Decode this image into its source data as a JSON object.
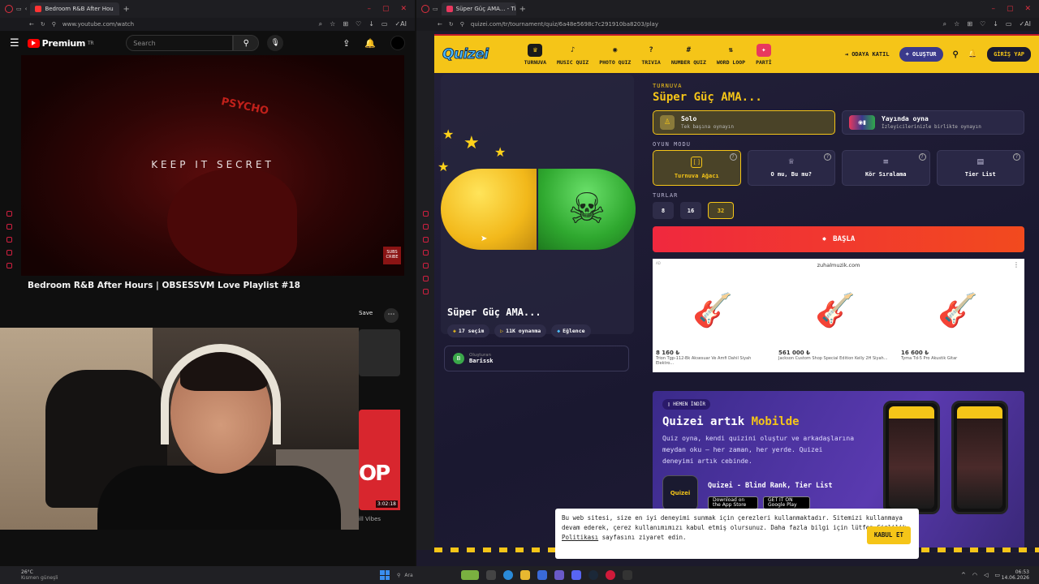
{
  "left_window": {
    "tab_title": "Bedroom R&B After Hou",
    "url": "www.youtube.com/watch",
    "youtube": {
      "brand": "Premium",
      "brand_sup": "TR",
      "search_placeholder": "Search",
      "video_text_top": "PSYCHO",
      "video_text_main": "KEEP IT SECRET",
      "subscribe_badge": "SUBS CRIBE",
      "video_title": "Bedroom R&B After Hours | OBSESSVM Love Playlist #18",
      "save_label": "Save",
      "thumb_text": "OP",
      "thumb_duration": "3:02:18",
      "thumb_channel": "ill Vibes"
    }
  },
  "right_window": {
    "tab_title": "Süper Güç AMA... - Tier Lis",
    "url": "quizei.com/tr/tournament/quiz/6a48e5698c7c291910ba8203/play",
    "site": {
      "logo": "Quizei",
      "menu": [
        {
          "label": "TURNUVA",
          "icon": "trophy-icon",
          "glyph": "♛"
        },
        {
          "label": "MUSIC QUIZ",
          "icon": "music-note-icon",
          "glyph": "♪"
        },
        {
          "label": "PHOTO QUIZ",
          "icon": "camera-icon",
          "glyph": "◉"
        },
        {
          "label": "TRIVIA",
          "icon": "help-circle-icon",
          "glyph": "?"
        },
        {
          "label": "NUMBER QUIZ",
          "icon": "hash-icon",
          "glyph": "#"
        },
        {
          "label": "WORD LOOP",
          "icon": "sort-icon",
          "glyph": "⇅"
        },
        {
          "label": "PARTİ",
          "icon": "party-icon",
          "glyph": "✦"
        }
      ],
      "join_room": "ODAYA KATIL",
      "create": "+ OLUŞTUR",
      "login": "GİRİŞ YAP",
      "quiz": {
        "title": "Süper Güç AMA...",
        "picks": "17 seçim",
        "plays": "11K oynanma",
        "category": "Eğlence",
        "creator_label": "Oluşturan",
        "creator_initial": "B",
        "creator_name": "Barissk"
      },
      "panel": {
        "kicker": "TURNUVA",
        "title": "Süper Güç AMA...",
        "solo_title": "Solo",
        "solo_sub": "Tek başına oynayın",
        "live_title": "Yayında oyna",
        "live_sub": "İzleyicilerinizle birlikte oynayın",
        "mode_section": "OYUN MODU",
        "modes": [
          "Turnuva Ağacı",
          "O mu, Bu mu?",
          "Kör Sıralama",
          "Tier List"
        ],
        "rounds_section": "TURLAR",
        "rounds": [
          "8",
          "16",
          "32"
        ],
        "start": "BAŞLA"
      },
      "ad": {
        "domain": "zuhalmuzik.com",
        "tag": "AD",
        "products": [
          {
            "price": "8 160 ₺",
            "name": "Trion Tgp-112-Bk Aksesuar Ve Amfi Dahil Siyah Elektro..."
          },
          {
            "price": "561 000 ₺",
            "name": "Jackson Custom Shop Special Edition Kelly 2H Siyah..."
          },
          {
            "price": "16 600 ₺",
            "name": "Tyma Td-5 Pro Akustik Gitar"
          }
        ]
      },
      "promo": {
        "badge": "HEMEN İNDİR",
        "heading_pre": "Quizei artık ",
        "heading_hl": "Mobilde",
        "body": "Quiz oyna, kendi quizini oluştur ve arkadaşlarına meydan oku — her zaman, her yerde. Quizei deneyimi artık cebinde.",
        "app_name": "Quizei - Blind Rank, Tier List",
        "app_icon_text": "Quizei",
        "appstore": "Download on the App Store",
        "playstore": "GET IT ON Google Play"
      },
      "cookie": {
        "text1": "Bu web sitesi, size en iyi deneyimi sunmak için çerezleri kullanmaktadır. Sitemizi kullanmaya devam ederek, çerez kullanımımızı kabul etmiş olursunuz. Daha fazla bilgi için lütfen ",
        "link": "Gizlilik Politikası",
        "text2": " sayfasını ziyaret edin.",
        "accept": "KABUL ET"
      }
    }
  },
  "taskbar": {
    "temp": "26°C",
    "weather": "Kısmen güneşli",
    "search": "Ara",
    "time": "06:53",
    "date": "14.06.2026"
  },
  "colors": {
    "accent": "#f5c518",
    "start": "#f0283e",
    "yt_red": "#ff0000"
  }
}
